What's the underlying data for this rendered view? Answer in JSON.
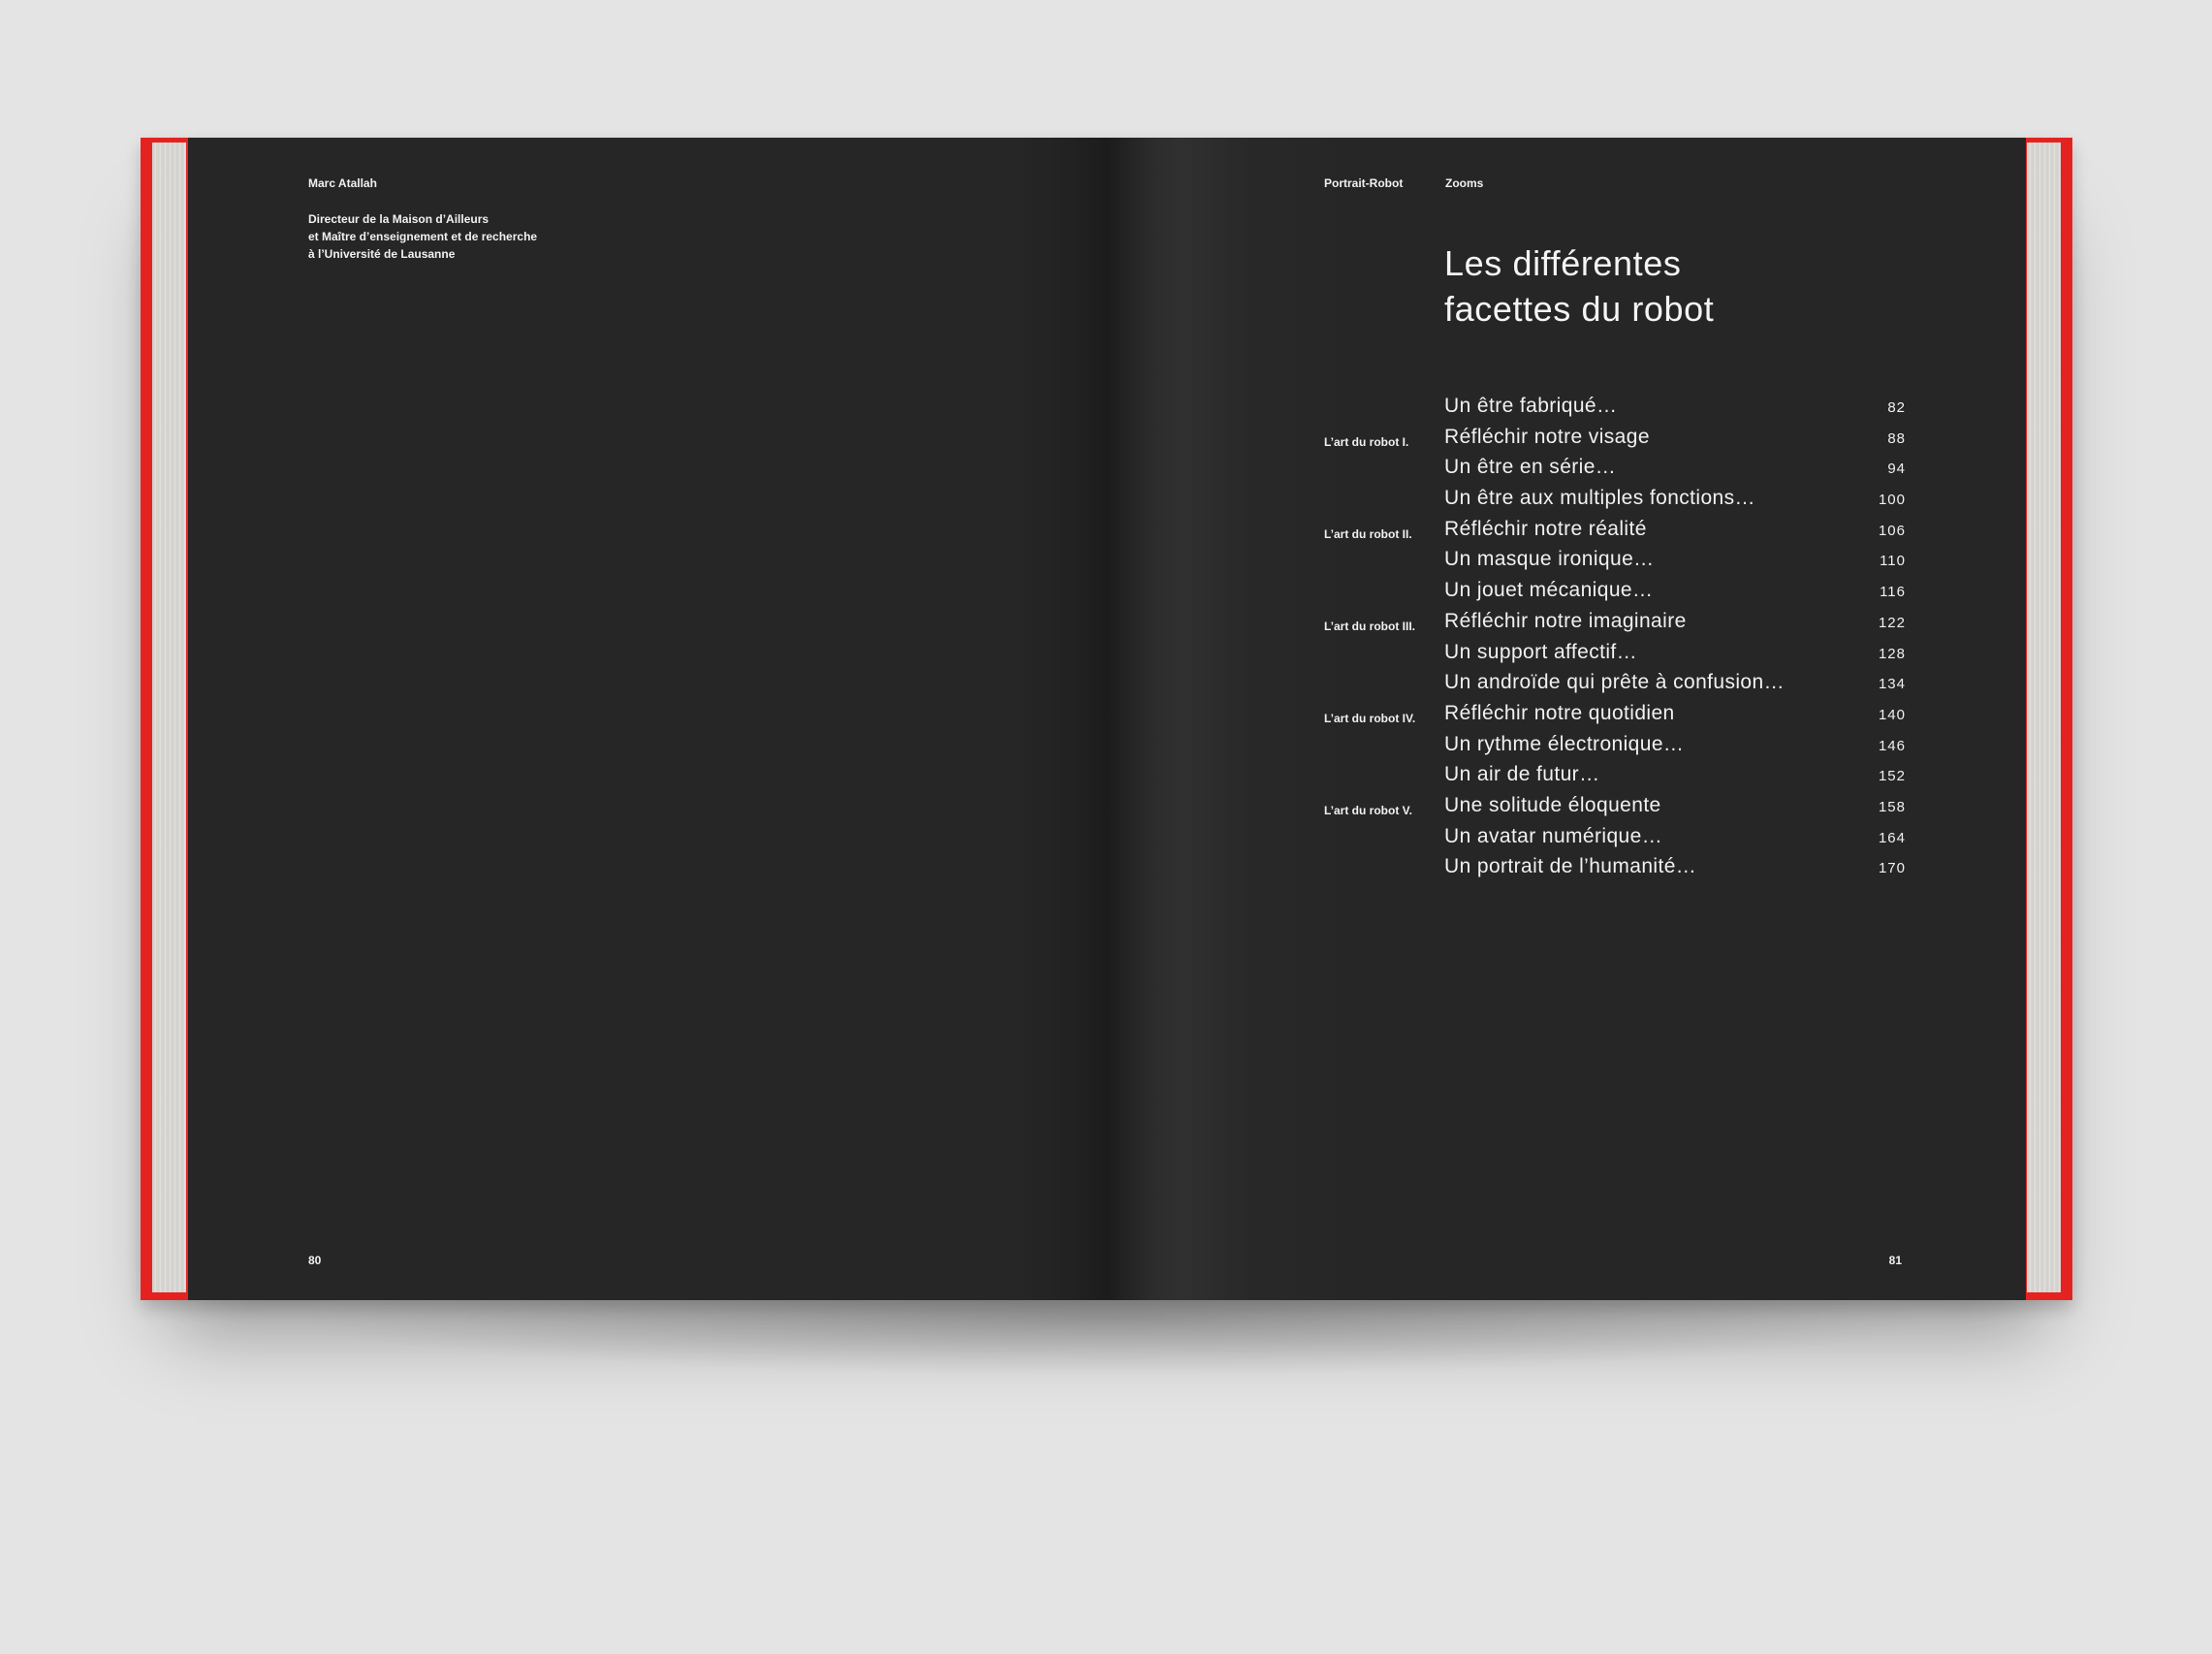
{
  "left_page": {
    "author_name": "Marc Atallah",
    "author_role": [
      "Directeur de la Maison d’Ailleurs",
      "et Maître d’enseignement et de recherche",
      "à l’Université de Lausanne"
    ],
    "folio": "80"
  },
  "right_page": {
    "running_head": [
      "Portrait-Robot",
      "Zooms"
    ],
    "title": [
      "Les différentes",
      "facettes du robot"
    ],
    "toc": [
      {
        "part": "",
        "entry": "Un être fabriqué…",
        "page": "82"
      },
      {
        "part": "L’art du robot I.",
        "entry": "Réfléchir notre visage",
        "page": "88"
      },
      {
        "part": "",
        "entry": "Un être en série…",
        "page": "94"
      },
      {
        "part": "",
        "entry": "Un être aux multiples fonctions…",
        "page": "100"
      },
      {
        "part": "L’art du robot II.",
        "entry": "Réfléchir notre réalité",
        "page": "106"
      },
      {
        "part": "",
        "entry": "Un masque ironique…",
        "page": "110"
      },
      {
        "part": "",
        "entry": "Un jouet mécanique…",
        "page": "116"
      },
      {
        "part": "L’art du robot III.",
        "entry": "Réfléchir notre imaginaire",
        "page": "122"
      },
      {
        "part": "",
        "entry": "Un support affectif…",
        "page": "128"
      },
      {
        "part": "",
        "entry": "Un androïde qui prête à confusion…",
        "page": "134"
      },
      {
        "part": "L’art du robot IV.",
        "entry": "Réfléchir notre quotidien",
        "page": "140"
      },
      {
        "part": "",
        "entry": "Un rythme électronique…",
        "page": "146"
      },
      {
        "part": "",
        "entry": "Un air de futur…",
        "page": "152"
      },
      {
        "part": "L’art du robot V.",
        "entry": "Une solitude éloquente",
        "page": "158"
      },
      {
        "part": "",
        "entry": "Un avatar numérique…",
        "page": "164"
      },
      {
        "part": "",
        "entry": "Un portrait de l’humanité…",
        "page": "170"
      }
    ],
    "folio": "81"
  },
  "colors": {
    "background": "#e4e4e4",
    "cover": "#e42320",
    "page": "#262626",
    "text": "#f1f1f1"
  }
}
